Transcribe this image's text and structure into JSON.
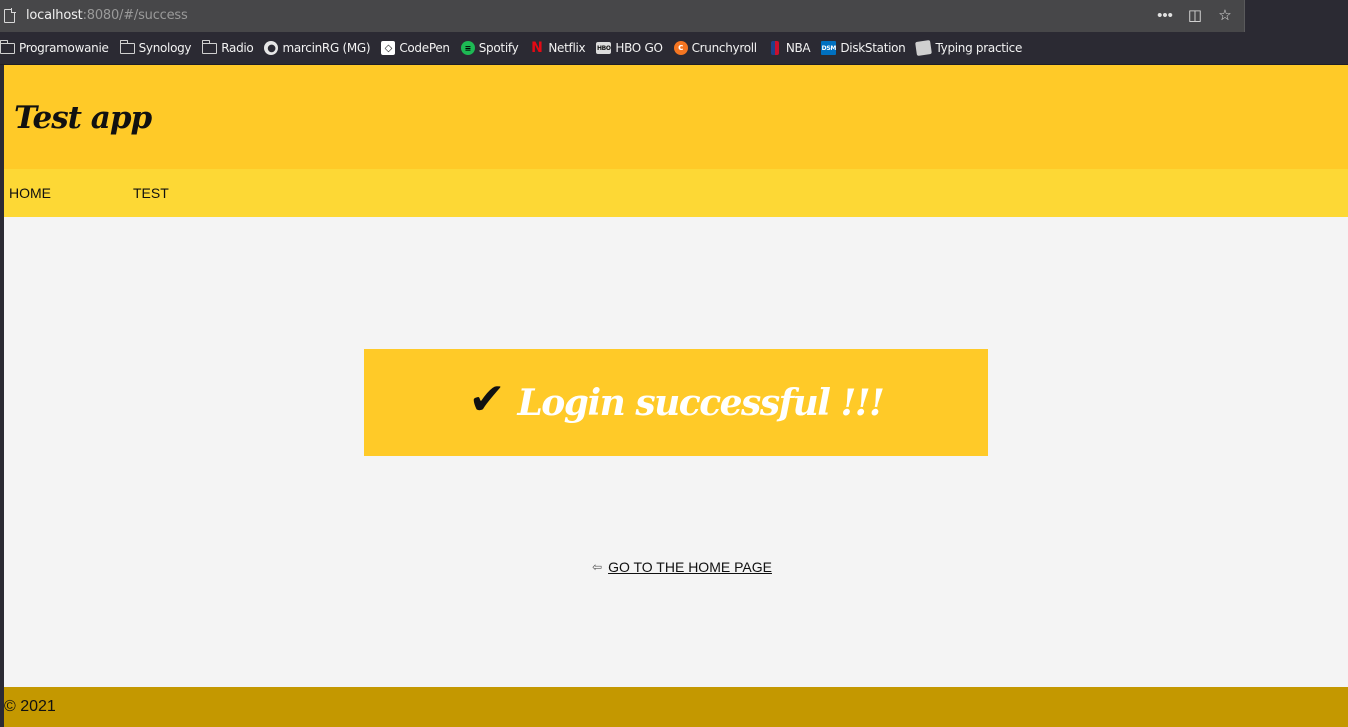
{
  "browser": {
    "url_host": "localhost",
    "url_rest": ":8080/#/success",
    "bookmarks": [
      {
        "label": "Programowanie",
        "icon": "folder-icon"
      },
      {
        "label": "Synology",
        "icon": "folder-icon"
      },
      {
        "label": "Radio",
        "icon": "folder-icon"
      },
      {
        "label": "marcinRG (MG)",
        "icon": "github-icon"
      },
      {
        "label": "CodePen",
        "icon": "codepen-icon"
      },
      {
        "label": "Spotify",
        "icon": "spotify-icon"
      },
      {
        "label": "Netflix",
        "icon": "netflix-icon"
      },
      {
        "label": "HBO GO",
        "icon": "hbo-icon"
      },
      {
        "label": "Crunchyroll",
        "icon": "crunchyroll-icon"
      },
      {
        "label": "NBA",
        "icon": "nba-icon"
      },
      {
        "label": "DiskStation",
        "icon": "dsm-icon"
      },
      {
        "label": "Typing practice",
        "icon": "typing-icon"
      }
    ]
  },
  "app": {
    "title": "Test app",
    "nav": [
      "HOME",
      "TEST"
    ],
    "success": {
      "check": "✔",
      "message": "Login successful !!!"
    },
    "back_arrow": "⇦",
    "home_link": "GO TO THE HOME PAGE",
    "footer": "© 2021"
  },
  "colors": {
    "header": "#ffca28",
    "nav": "#fdd835",
    "footer": "#c49800",
    "page_bg": "#f4f4f4"
  }
}
